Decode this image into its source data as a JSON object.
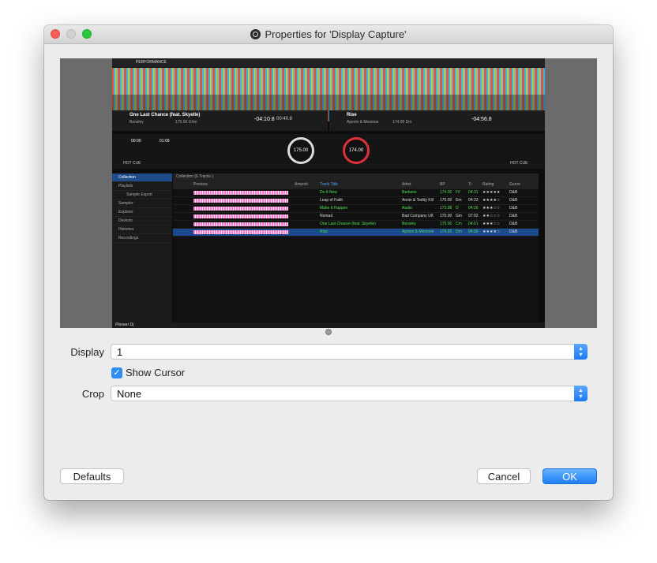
{
  "window": {
    "title": "Properties for 'Display Capture'"
  },
  "preview_screen": {
    "deck1": {
      "title": "One Last Chance (feat. Skyelle)",
      "artist": "Bensley",
      "bpm": "175.00 G#m",
      "time_elapsed": "-04:10.8",
      "time_remain": "00:40.8",
      "tempo": "175.00"
    },
    "deck2": {
      "title": "Rise",
      "artist": "Apexio & Mesmoe",
      "bpm": "174.00 Dm",
      "time": "-04:56.8",
      "tempo": "174.00"
    },
    "mode": "PERFORMANCE",
    "cue1": "00:00",
    "cue2": "01:09",
    "hotcue": "HOT CUE",
    "collection_header": "Collection (6 Tracks )",
    "sidebar": [
      "Collection",
      "Playlists",
      "Sample Export",
      "Sampler",
      "Explorer",
      "Devices",
      "Histories",
      "Recordings"
    ],
    "columns": [
      "Preview",
      "Artwork",
      "Track Title",
      "Artist",
      "BP",
      "Ti",
      "Rating",
      "Genre"
    ],
    "tracks": [
      {
        "title": "Do It Now",
        "artist": "Barbarix",
        "bpm": "174.00",
        "key": "F#",
        "time": "04:31",
        "rating": "★★★★★",
        "genre": "D&B"
      },
      {
        "title": "Leap of Faith",
        "artist": "Annix & Teddy Kill",
        "bpm": "175.00",
        "key": "Em",
        "time": "04:23",
        "rating": "★★★★☆",
        "genre": "D&B"
      },
      {
        "title": "Make It Happen",
        "artist": "Audio",
        "bpm": "173.98",
        "key": "D",
        "time": "04:26",
        "rating": "★★★☆☆",
        "genre": "D&B"
      },
      {
        "title": "Nomad",
        "artist": "Bad Company UK",
        "bpm": "170.00",
        "key": "Gm",
        "time": "07:02",
        "rating": "★★☆☆☆",
        "genre": "D&B"
      },
      {
        "title": "One Last Chance (feat. Skyelle)",
        "artist": "Bensley",
        "bpm": "175.00",
        "key": "Cm",
        "time": "04:51",
        "rating": "★★★☆☆",
        "genre": "D&B"
      },
      {
        "title": "Rise",
        "artist": "Apexio & Mesmoe",
        "bpm": "174.00",
        "key": "Dm",
        "time": "04:56",
        "rating": "★★★★☆",
        "genre": "D&B"
      }
    ],
    "brand": "Pioneer Dj"
  },
  "form": {
    "display_label": "Display",
    "display_value": "1",
    "show_cursor_label": "Show Cursor",
    "show_cursor_checked": true,
    "crop_label": "Crop",
    "crop_value": "None"
  },
  "buttons": {
    "defaults": "Defaults",
    "cancel": "Cancel",
    "ok": "OK"
  }
}
